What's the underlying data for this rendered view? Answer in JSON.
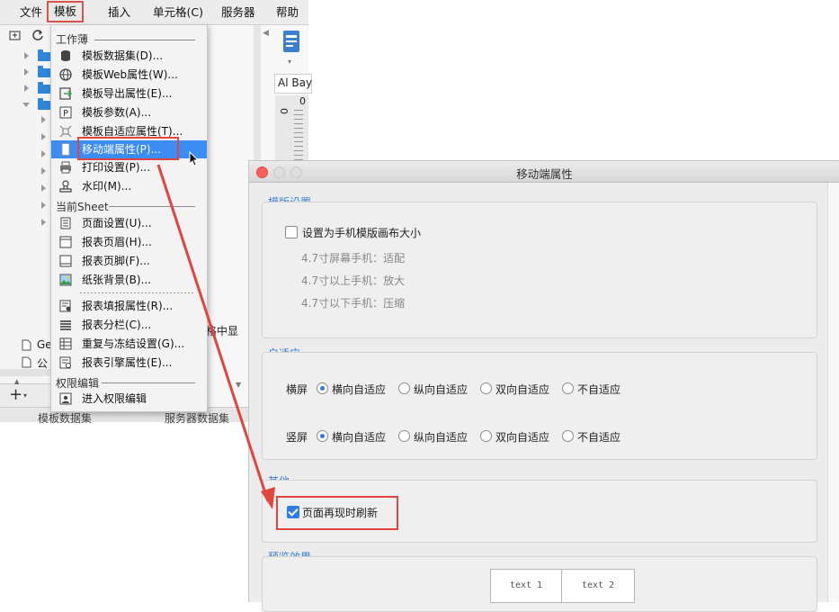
{
  "menubar": {
    "items": [
      "文件",
      "模板",
      "插入",
      "单元格(C)",
      "服务器",
      "帮助"
    ]
  },
  "dropdown": {
    "section_workbook": "工作薄",
    "workbook_items": [
      {
        "label": "模板数据集(D)...",
        "icon": "database-icon"
      },
      {
        "label": "模板Web属性(W)...",
        "icon": "globe-icon"
      },
      {
        "label": "模板导出属性(E)...",
        "icon": "export-icon"
      },
      {
        "label": "模板参数(A)...",
        "icon": "parameter-icon"
      },
      {
        "label": "模板自适应属性(T)...",
        "icon": "adaptive-icon"
      },
      {
        "label": "移动端属性(P)...",
        "icon": "mobile-icon"
      },
      {
        "label": "打印设置(P)...",
        "icon": "printer-icon"
      },
      {
        "label": "水印(M)...",
        "icon": "stamp-icon"
      }
    ],
    "section_sheet": "当前Sheet",
    "sheet_items": [
      {
        "label": "页面设置(U)...",
        "icon": "page-setup-icon"
      },
      {
        "label": "报表页眉(H)...",
        "icon": "header-icon"
      },
      {
        "label": "报表页脚(F)...",
        "icon": "footer-icon"
      },
      {
        "label": "纸张背景(B)...",
        "icon": "image-icon"
      },
      {
        "label": "报表填报属性(R)...",
        "icon": "form-icon"
      },
      {
        "label": "报表分栏(C)...",
        "icon": "columns-icon"
      },
      {
        "label": "重复与冻结设置(G)...",
        "icon": "freeze-icon"
      },
      {
        "label": "报表引擎属性(E)...",
        "icon": "engine-icon"
      }
    ],
    "section_permission": "权限编辑",
    "permission_items": [
      {
        "label": "进入权限编辑",
        "icon": "permission-icon"
      }
    ]
  },
  "background": {
    "font_name": "Al Bay",
    "ruler_zero": "0",
    "ruler_zero_v": "0",
    "partial_text": "格中显",
    "tree_item_1": "Ge",
    "tree_item_2": "公",
    "bottom_left_partial": "模板数据集",
    "bottom_right_partial": "服务器数据集"
  },
  "dialog": {
    "title": "移动端属性",
    "template_group": {
      "title": "模版设置",
      "checkbox_label": "设置为手机模版画布大小",
      "checked": false,
      "hints": [
        "4.7寸屏幕手机：适配",
        "4.7寸以上手机：放大",
        "4.7寸以下手机：压缩"
      ]
    },
    "adaptive_group": {
      "title": "自适应",
      "rows": [
        {
          "label": "横屏",
          "options": [
            "横向自适应",
            "纵向自适应",
            "双向自适应",
            "不自适应"
          ],
          "selected": 0
        },
        {
          "label": "竖屏",
          "options": [
            "横向自适应",
            "纵向自适应",
            "双向自适应",
            "不自适应"
          ],
          "selected": 0
        }
      ]
    },
    "other_group": {
      "title": "其他",
      "checkbox_label": "页面再现时刷新",
      "checked": true
    },
    "preview_group": {
      "title": "预览效果",
      "cells": [
        "text 1",
        "text 2"
      ]
    }
  },
  "colors": {
    "highlight": "#3b8cf3",
    "annotation_red": "#e0453e",
    "group_title": "#3a7fd0"
  }
}
